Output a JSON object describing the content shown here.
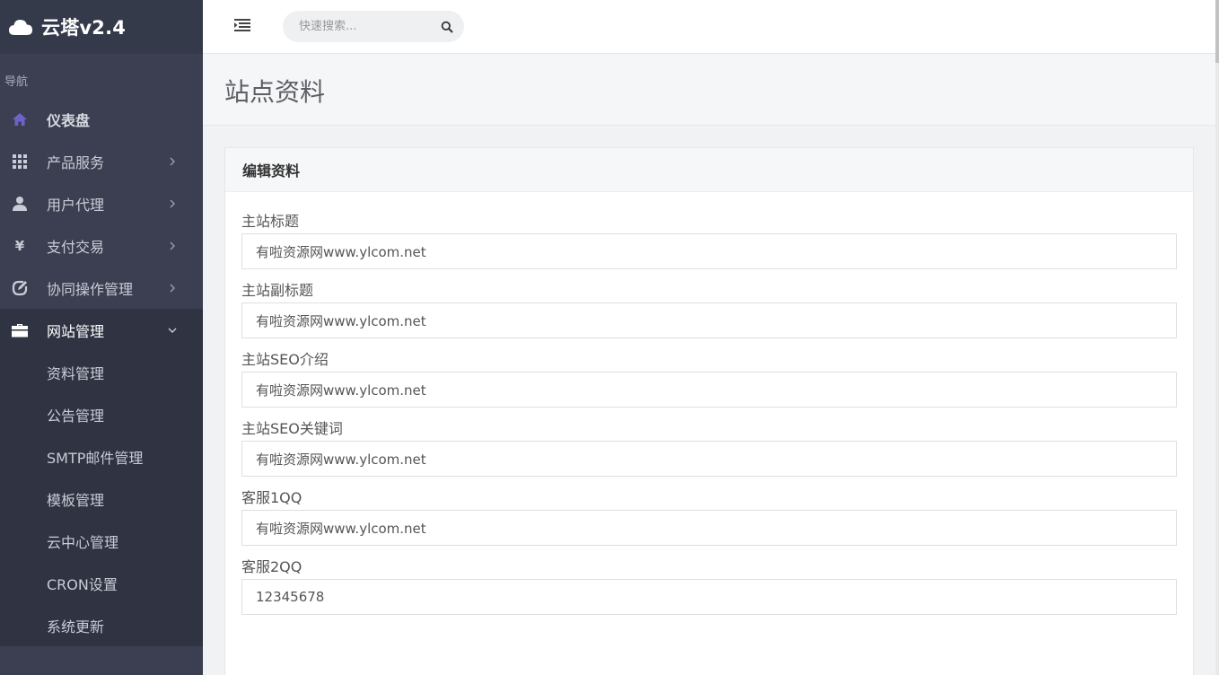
{
  "brand": {
    "title": "云塔v2.4",
    "icon": "cloud-icon"
  },
  "sidebar": {
    "heading": "导航",
    "items": [
      {
        "label": "仪表盘",
        "icon": "home-icon"
      },
      {
        "label": "产品服务",
        "icon": "grid-icon"
      },
      {
        "label": "用户代理",
        "icon": "user-icon"
      },
      {
        "label": "支付交易",
        "icon": "yen-icon"
      },
      {
        "label": "协同操作管理",
        "icon": "edit-icon"
      },
      {
        "label": "网站管理",
        "icon": "briefcase-icon"
      }
    ],
    "subitems": [
      "资料管理",
      "公告管理",
      "SMTP邮件管理",
      "模板管理",
      "云中心管理",
      "CRON设置",
      "系统更新"
    ]
  },
  "header": {
    "search_placeholder": "快速搜索..."
  },
  "page": {
    "title": "站点资料"
  },
  "card": {
    "title": "编辑资料",
    "fields": [
      {
        "label": "主站标题",
        "value": "有啦资源网www.ylcom.net"
      },
      {
        "label": "主站副标题",
        "value": "有啦资源网www.ylcom.net"
      },
      {
        "label": "主站SEO介绍",
        "value": "有啦资源网www.ylcom.net"
      },
      {
        "label": "主站SEO关键词",
        "value": "有啦资源网www.ylcom.net"
      },
      {
        "label": "客服1QQ",
        "value": "有啦资源网www.ylcom.net"
      },
      {
        "label": "客服2QQ",
        "value": "12345678"
      }
    ]
  },
  "colors": {
    "sidebar_bg": "#3b3f51",
    "home_icon": "#6c63c7"
  }
}
